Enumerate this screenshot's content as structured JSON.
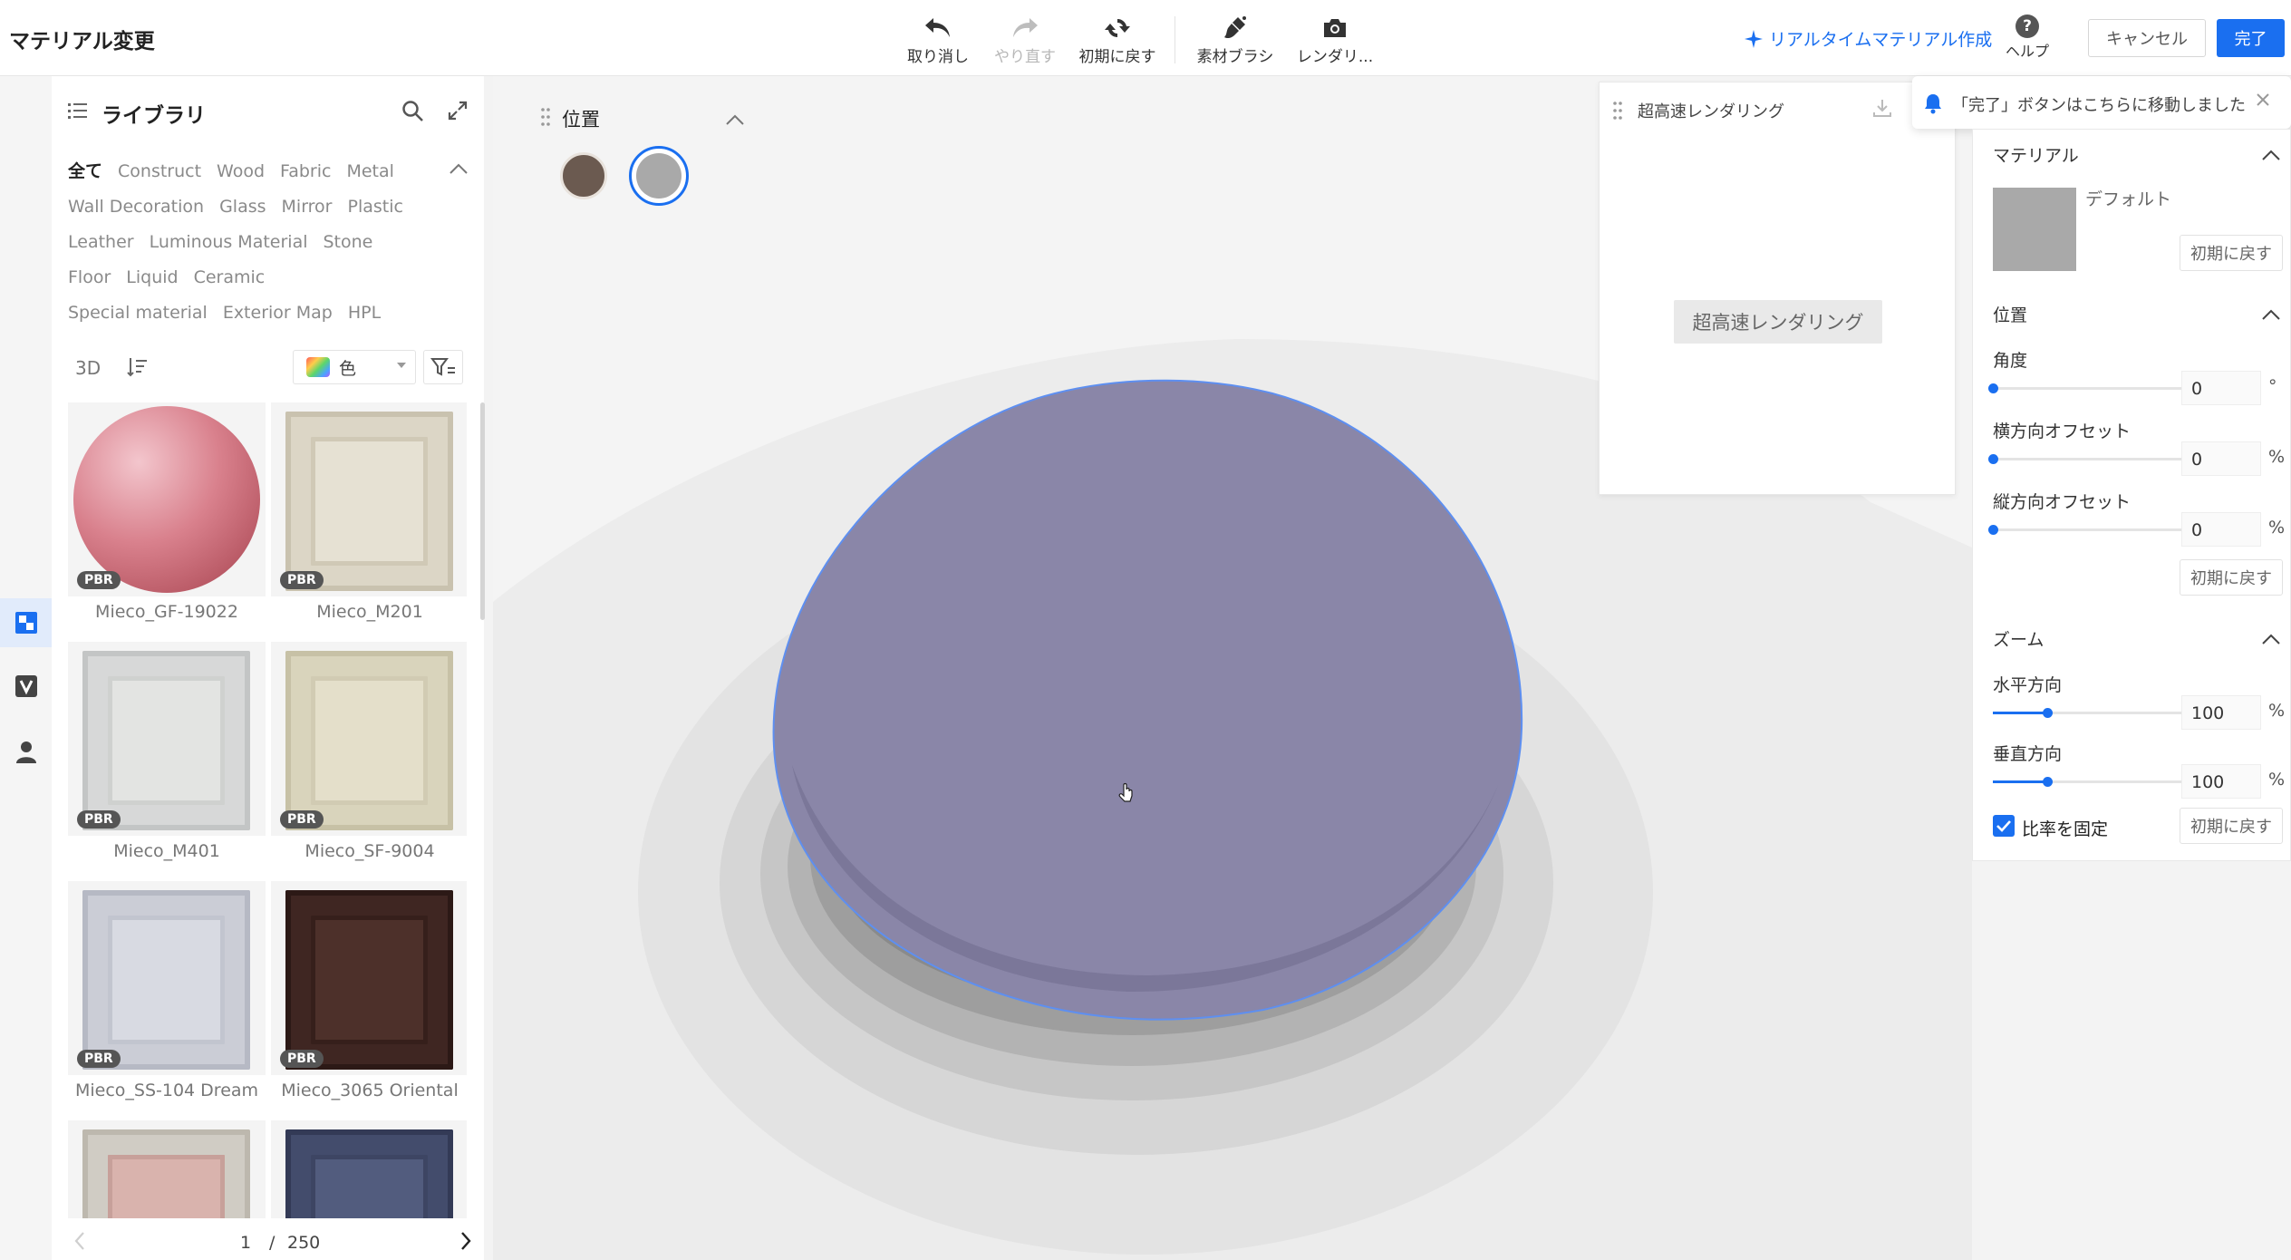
{
  "app": {
    "title": "マテリアル変更"
  },
  "toolbar": {
    "undo": "取り消し",
    "redo": "やり直す",
    "reset": "初期に戻す",
    "brush": "素材ブラシ",
    "render": "レンダリ..."
  },
  "header": {
    "realtime_link": "リアルタイムマテリアル作成",
    "help": "ヘルプ",
    "cancel": "キャンセル",
    "done": "完了"
  },
  "library": {
    "title": "ライブラリ",
    "categories": [
      "全て",
      "Construct",
      "Wood",
      "Fabric",
      "Metal",
      "Wall Decoration",
      "Glass",
      "Mirror",
      "Plastic",
      "Leather",
      "Luminous Material",
      "Stone",
      "Floor",
      "Liquid",
      "Ceramic",
      "Special material",
      "Exterior Map",
      "HPL"
    ],
    "view_3d": "3D",
    "color_filter": "色",
    "items": [
      {
        "name": "Mieco_GF-19022",
        "badge": "PBR"
      },
      {
        "name": "Mieco_M201",
        "badge": "PBR"
      },
      {
        "name": "Mieco_M401",
        "badge": "PBR"
      },
      {
        "name": "Mieco_SF-9004",
        "badge": "PBR"
      },
      {
        "name": "Mieco_SS-104 Dream",
        "badge": "PBR"
      },
      {
        "name": "Mieco_3065 Oriental",
        "badge": "PBR"
      },
      {
        "name": "",
        "badge": ""
      },
      {
        "name": "",
        "badge": ""
      }
    ],
    "pager": {
      "current": "1",
      "separator": "/",
      "total": "250"
    }
  },
  "position_panel": {
    "title": "位置"
  },
  "fast_render": {
    "title": "超高速レンダリング",
    "button": "超高速レンダリング"
  },
  "notice": {
    "text": "「完了」ボタンはこちらに移動しました"
  },
  "properties": {
    "material": {
      "title": "マテリアル",
      "name": "デフォルト",
      "reset": "初期に戻す"
    },
    "position": {
      "title": "位置",
      "angle": {
        "label": "角度",
        "value": "0",
        "unit": "°",
        "level": 0
      },
      "h_offset": {
        "label": "横方向オフセット",
        "value": "0",
        "unit": "%",
        "level": 0
      },
      "v_offset": {
        "label": "縦方向オフセット",
        "value": "0",
        "unit": "%",
        "level": 0
      },
      "reset": "初期に戻す"
    },
    "zoom": {
      "title": "ズーム",
      "horizontal": {
        "label": "水平方向",
        "value": "100",
        "unit": "%",
        "level": 0.25
      },
      "vertical": {
        "label": "垂直方向",
        "value": "100",
        "unit": "%",
        "level": 0.25
      },
      "lock_ratio": "比率を固定",
      "lock_checked": true,
      "reset": "初期に戻す"
    }
  },
  "colors": {
    "accent": "#1a6ff0",
    "object": "#8a86a8",
    "swatch_wood": "#6b5a50",
    "swatch_gray": "#a9a9a9"
  }
}
